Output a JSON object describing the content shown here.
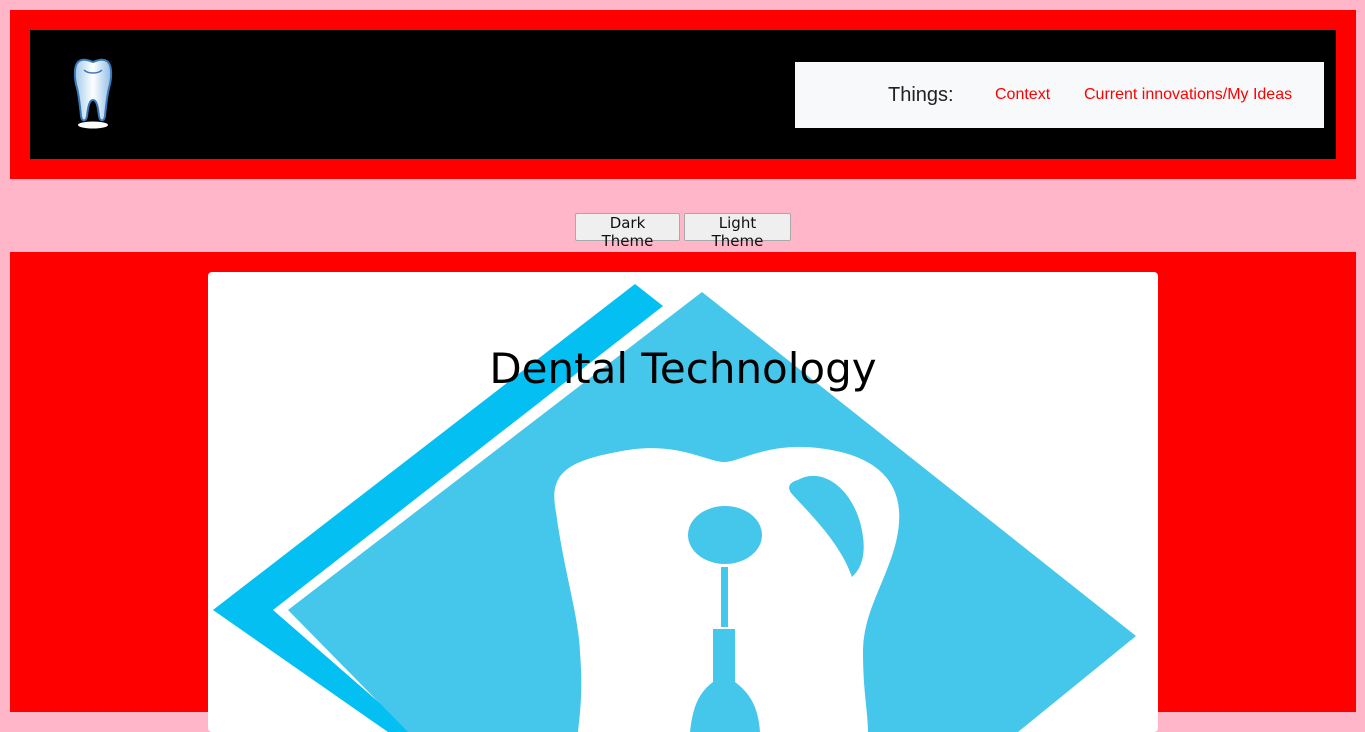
{
  "header": {
    "logo_icon": "tooth-icon",
    "nav": {
      "brand": "Things:",
      "links": [
        {
          "label": "Context"
        },
        {
          "label": "Current innovations/My Ideas"
        }
      ]
    }
  },
  "theme_buttons": {
    "dark": "Dark Theme",
    "light": "Light Theme"
  },
  "main": {
    "title": "Dental Technology",
    "hero_icon": "dental-technology-logo"
  },
  "colors": {
    "page_bg": "#ffb6c8",
    "frame": "#ff0000",
    "header_bg": "#000000",
    "nav_bg": "#f8f9fa",
    "link": "#ff0000",
    "hero_blue": "#45c6eb",
    "hero_stripe": "#03bff2"
  }
}
